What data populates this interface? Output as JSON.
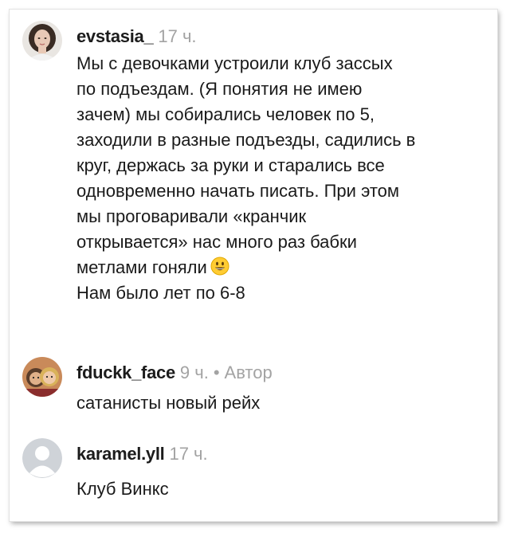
{
  "comments": [
    {
      "username": "evstasia_",
      "time": "17 ч.",
      "lines": [
        "Мы с девочками устроили клуб зассых",
        "по подъездам. (Я понятия не имею",
        "зачем) мы собирались человек по 5,",
        "заходили в разные подъезды, садились в",
        "круг, держась за руки и старались все",
        "одновременно начать писать. При этом",
        "мы проговаривали «кранчик",
        "открывается» нас много раз бабки",
        "метлами гоняли",
        "Нам было лет по 6-8"
      ],
      "emoji": "grinning-face-emoji"
    },
    {
      "username": "fduckk_face",
      "time": "9 ч.",
      "separator": "•",
      "author_label": "Автор",
      "lines": [
        "сатанисты новый рейх"
      ]
    },
    {
      "username": "karamel.yll",
      "time": "17 ч.",
      "lines": [
        "Клуб Винкс"
      ]
    }
  ],
  "icons": {
    "avatar_1": "profile-photo-avatar",
    "avatar_2": "profile-photo-avatar",
    "avatar_3": "default-user-avatar"
  },
  "colors": {
    "username": "#1c1c1c",
    "secondary_text": "#a3a3a3",
    "body_text": "#1a1a1a",
    "default_avatar_bg": "#cfd3d8"
  }
}
